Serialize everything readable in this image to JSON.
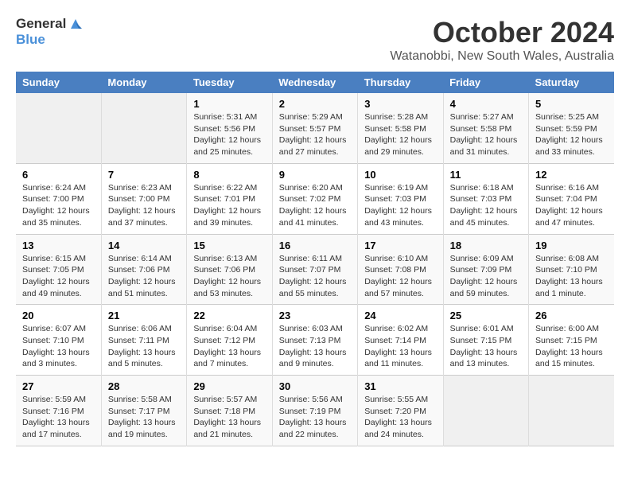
{
  "logo": {
    "line1": "General",
    "line2": "Blue"
  },
  "title": "October 2024",
  "subtitle": "Watanobbi, New South Wales, Australia",
  "weekdays": [
    "Sunday",
    "Monday",
    "Tuesday",
    "Wednesday",
    "Thursday",
    "Friday",
    "Saturday"
  ],
  "weeks": [
    [
      {
        "day": "",
        "empty": true
      },
      {
        "day": "",
        "empty": true
      },
      {
        "day": "1",
        "sunrise": "Sunrise: 5:31 AM",
        "sunset": "Sunset: 5:56 PM",
        "daylight": "Daylight: 12 hours and 25 minutes."
      },
      {
        "day": "2",
        "sunrise": "Sunrise: 5:29 AM",
        "sunset": "Sunset: 5:57 PM",
        "daylight": "Daylight: 12 hours and 27 minutes."
      },
      {
        "day": "3",
        "sunrise": "Sunrise: 5:28 AM",
        "sunset": "Sunset: 5:58 PM",
        "daylight": "Daylight: 12 hours and 29 minutes."
      },
      {
        "day": "4",
        "sunrise": "Sunrise: 5:27 AM",
        "sunset": "Sunset: 5:58 PM",
        "daylight": "Daylight: 12 hours and 31 minutes."
      },
      {
        "day": "5",
        "sunrise": "Sunrise: 5:25 AM",
        "sunset": "Sunset: 5:59 PM",
        "daylight": "Daylight: 12 hours and 33 minutes."
      }
    ],
    [
      {
        "day": "6",
        "sunrise": "Sunrise: 6:24 AM",
        "sunset": "Sunset: 7:00 PM",
        "daylight": "Daylight: 12 hours and 35 minutes."
      },
      {
        "day": "7",
        "sunrise": "Sunrise: 6:23 AM",
        "sunset": "Sunset: 7:00 PM",
        "daylight": "Daylight: 12 hours and 37 minutes."
      },
      {
        "day": "8",
        "sunrise": "Sunrise: 6:22 AM",
        "sunset": "Sunset: 7:01 PM",
        "daylight": "Daylight: 12 hours and 39 minutes."
      },
      {
        "day": "9",
        "sunrise": "Sunrise: 6:20 AM",
        "sunset": "Sunset: 7:02 PM",
        "daylight": "Daylight: 12 hours and 41 minutes."
      },
      {
        "day": "10",
        "sunrise": "Sunrise: 6:19 AM",
        "sunset": "Sunset: 7:03 PM",
        "daylight": "Daylight: 12 hours and 43 minutes."
      },
      {
        "day": "11",
        "sunrise": "Sunrise: 6:18 AM",
        "sunset": "Sunset: 7:03 PM",
        "daylight": "Daylight: 12 hours and 45 minutes."
      },
      {
        "day": "12",
        "sunrise": "Sunrise: 6:16 AM",
        "sunset": "Sunset: 7:04 PM",
        "daylight": "Daylight: 12 hours and 47 minutes."
      }
    ],
    [
      {
        "day": "13",
        "sunrise": "Sunrise: 6:15 AM",
        "sunset": "Sunset: 7:05 PM",
        "daylight": "Daylight: 12 hours and 49 minutes."
      },
      {
        "day": "14",
        "sunrise": "Sunrise: 6:14 AM",
        "sunset": "Sunset: 7:06 PM",
        "daylight": "Daylight: 12 hours and 51 minutes."
      },
      {
        "day": "15",
        "sunrise": "Sunrise: 6:13 AM",
        "sunset": "Sunset: 7:06 PM",
        "daylight": "Daylight: 12 hours and 53 minutes."
      },
      {
        "day": "16",
        "sunrise": "Sunrise: 6:11 AM",
        "sunset": "Sunset: 7:07 PM",
        "daylight": "Daylight: 12 hours and 55 minutes."
      },
      {
        "day": "17",
        "sunrise": "Sunrise: 6:10 AM",
        "sunset": "Sunset: 7:08 PM",
        "daylight": "Daylight: 12 hours and 57 minutes."
      },
      {
        "day": "18",
        "sunrise": "Sunrise: 6:09 AM",
        "sunset": "Sunset: 7:09 PM",
        "daylight": "Daylight: 12 hours and 59 minutes."
      },
      {
        "day": "19",
        "sunrise": "Sunrise: 6:08 AM",
        "sunset": "Sunset: 7:10 PM",
        "daylight": "Daylight: 13 hours and 1 minute."
      }
    ],
    [
      {
        "day": "20",
        "sunrise": "Sunrise: 6:07 AM",
        "sunset": "Sunset: 7:10 PM",
        "daylight": "Daylight: 13 hours and 3 minutes."
      },
      {
        "day": "21",
        "sunrise": "Sunrise: 6:06 AM",
        "sunset": "Sunset: 7:11 PM",
        "daylight": "Daylight: 13 hours and 5 minutes."
      },
      {
        "day": "22",
        "sunrise": "Sunrise: 6:04 AM",
        "sunset": "Sunset: 7:12 PM",
        "daylight": "Daylight: 13 hours and 7 minutes."
      },
      {
        "day": "23",
        "sunrise": "Sunrise: 6:03 AM",
        "sunset": "Sunset: 7:13 PM",
        "daylight": "Daylight: 13 hours and 9 minutes."
      },
      {
        "day": "24",
        "sunrise": "Sunrise: 6:02 AM",
        "sunset": "Sunset: 7:14 PM",
        "daylight": "Daylight: 13 hours and 11 minutes."
      },
      {
        "day": "25",
        "sunrise": "Sunrise: 6:01 AM",
        "sunset": "Sunset: 7:15 PM",
        "daylight": "Daylight: 13 hours and 13 minutes."
      },
      {
        "day": "26",
        "sunrise": "Sunrise: 6:00 AM",
        "sunset": "Sunset: 7:15 PM",
        "daylight": "Daylight: 13 hours and 15 minutes."
      }
    ],
    [
      {
        "day": "27",
        "sunrise": "Sunrise: 5:59 AM",
        "sunset": "Sunset: 7:16 PM",
        "daylight": "Daylight: 13 hours and 17 minutes."
      },
      {
        "day": "28",
        "sunrise": "Sunrise: 5:58 AM",
        "sunset": "Sunset: 7:17 PM",
        "daylight": "Daylight: 13 hours and 19 minutes."
      },
      {
        "day": "29",
        "sunrise": "Sunrise: 5:57 AM",
        "sunset": "Sunset: 7:18 PM",
        "daylight": "Daylight: 13 hours and 21 minutes."
      },
      {
        "day": "30",
        "sunrise": "Sunrise: 5:56 AM",
        "sunset": "Sunset: 7:19 PM",
        "daylight": "Daylight: 13 hours and 22 minutes."
      },
      {
        "day": "31",
        "sunrise": "Sunrise: 5:55 AM",
        "sunset": "Sunset: 7:20 PM",
        "daylight": "Daylight: 13 hours and 24 minutes."
      },
      {
        "day": "",
        "empty": true
      },
      {
        "day": "",
        "empty": true
      }
    ]
  ]
}
